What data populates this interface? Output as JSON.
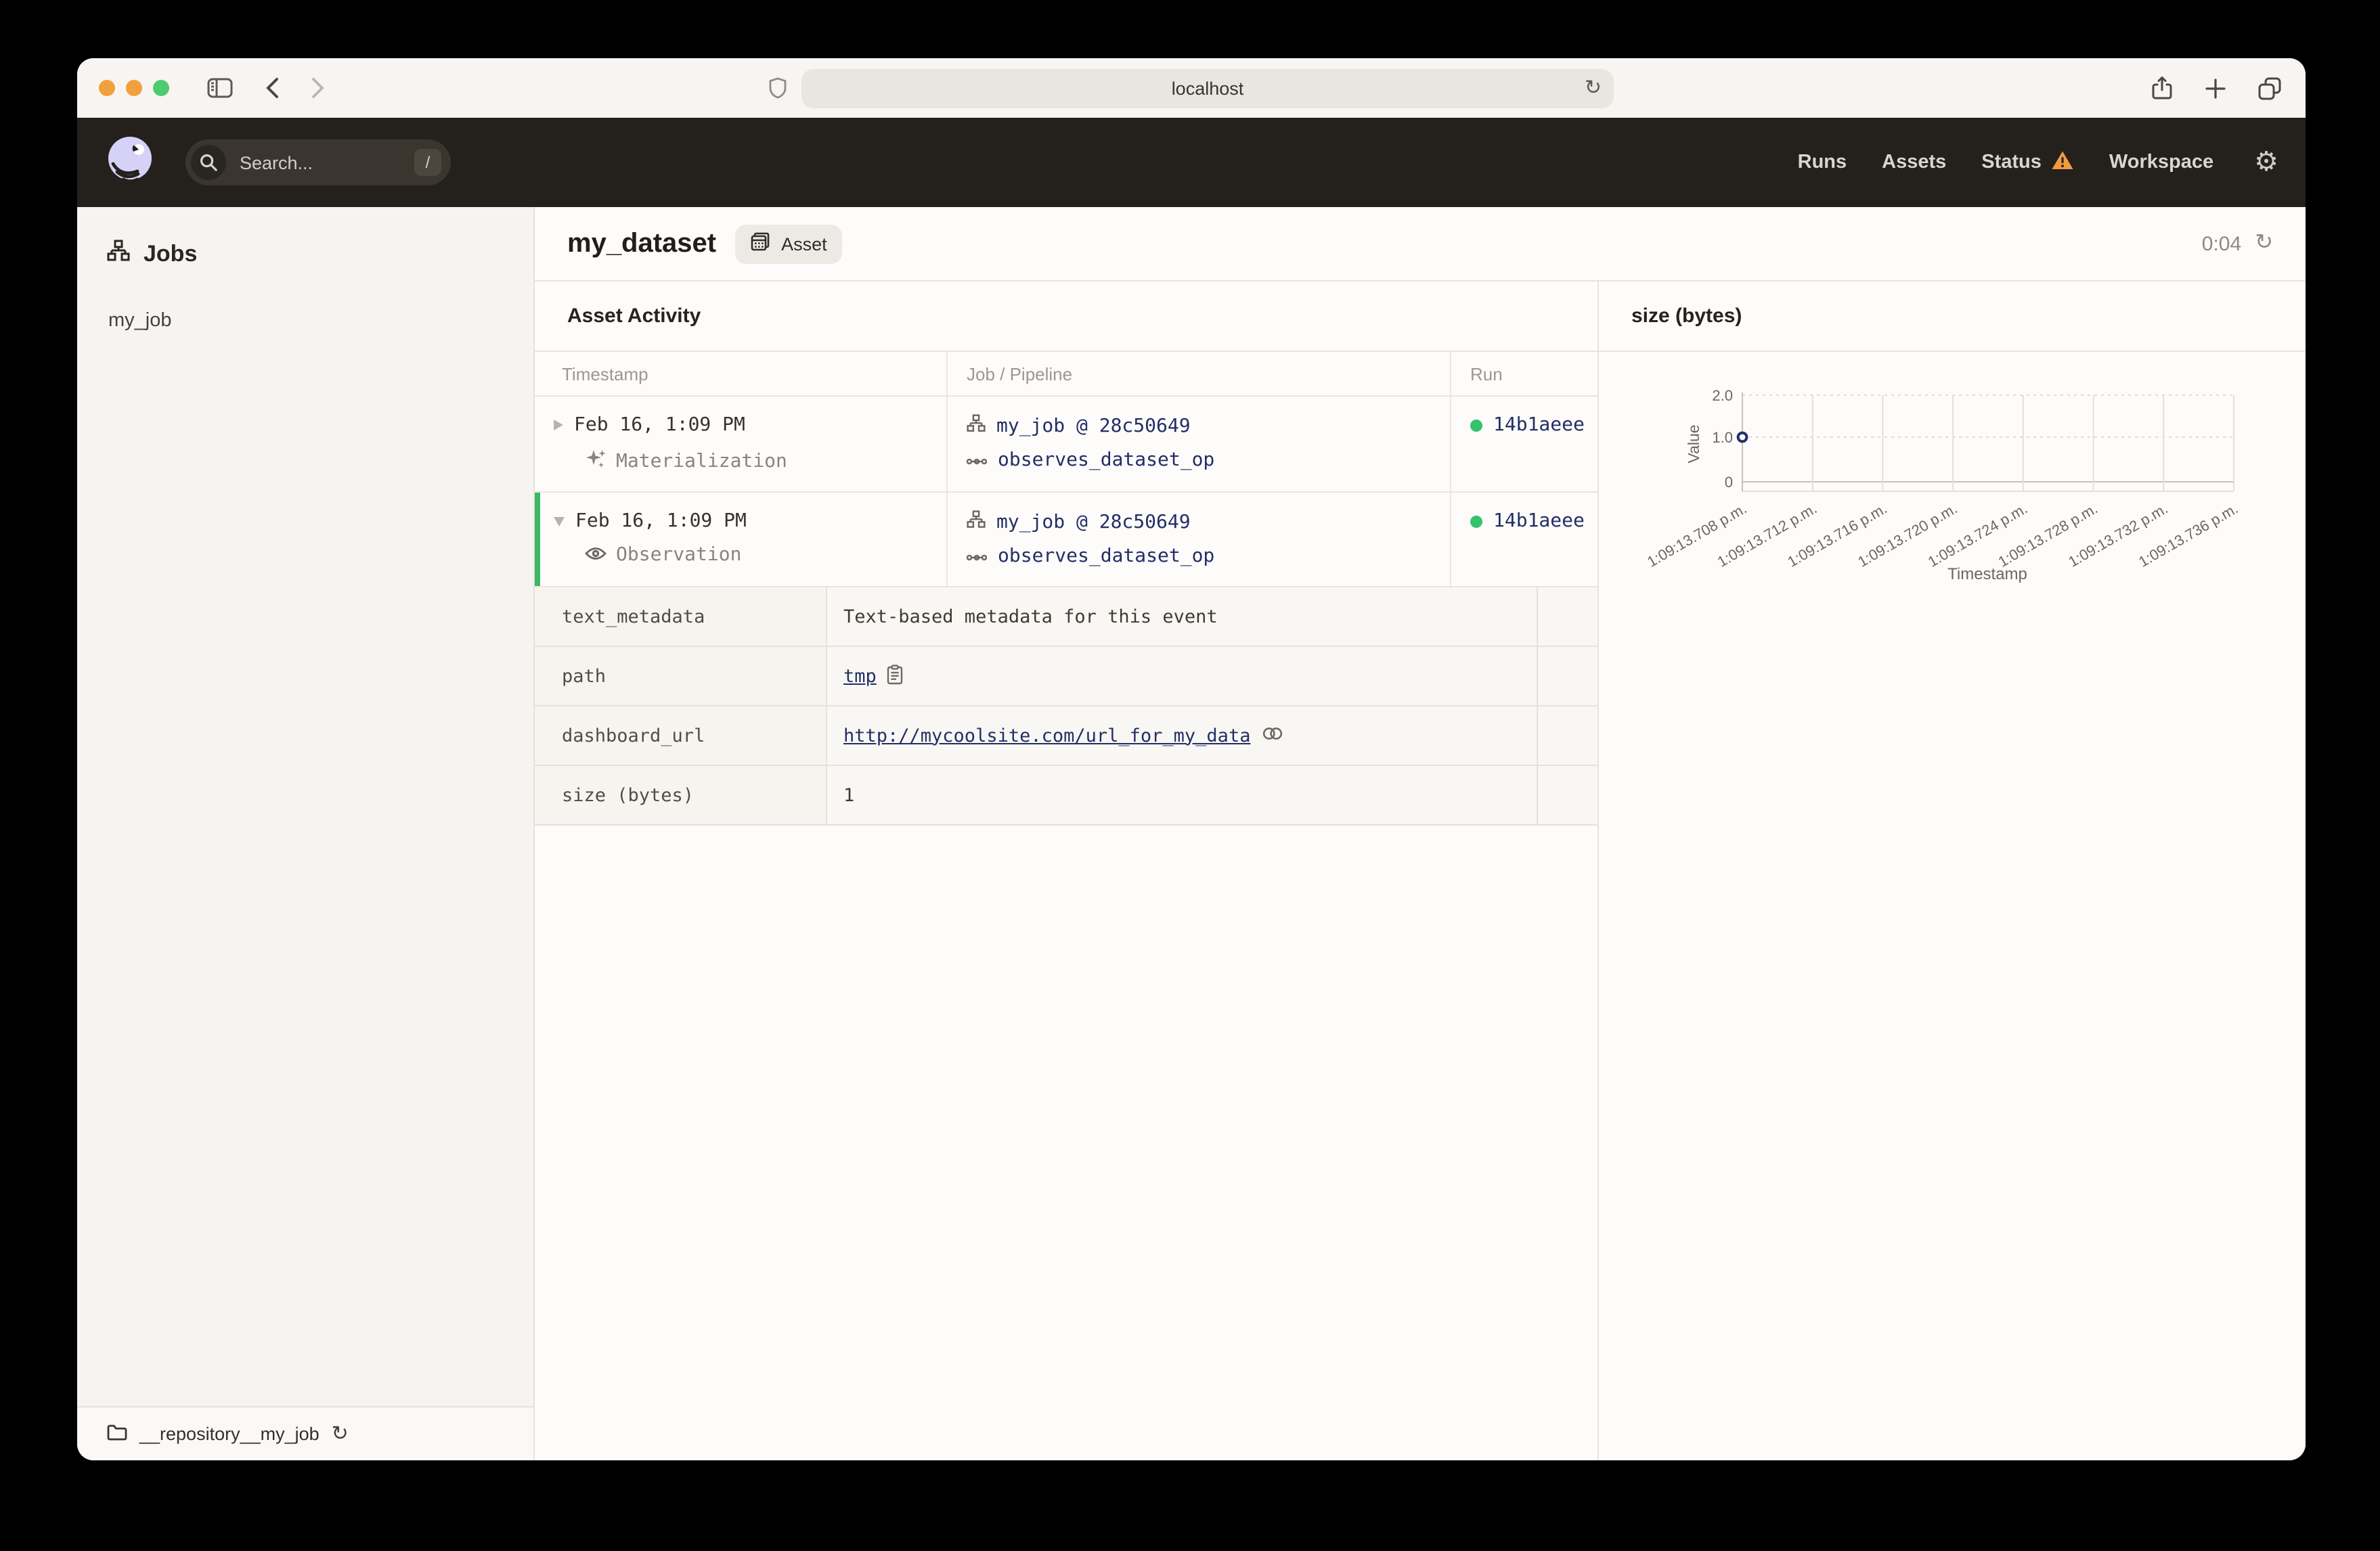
{
  "browser": {
    "url": "localhost"
  },
  "header": {
    "search_placeholder": "Search...",
    "search_shortcut": "/",
    "nav_runs": "Runs",
    "nav_assets": "Assets",
    "nav_status": "Status",
    "nav_workspace": "Workspace"
  },
  "sidebar": {
    "section_title": "Jobs",
    "jobs": [
      {
        "name": "my_job"
      }
    ],
    "repository": "__repository__my_job"
  },
  "page": {
    "title": "my_dataset",
    "badge": "Asset",
    "timer": "0:04"
  },
  "activity": {
    "panel_title": "Asset Activity",
    "col_timestamp": "Timestamp",
    "col_job": "Job / Pipeline",
    "col_run": "Run",
    "rows": [
      {
        "timestamp": "Feb 16, 1:09 PM",
        "event_type": "Materialization",
        "job": "my_job @ 28c50649",
        "op": "observes_dataset_op",
        "run_id": "14b1aeee",
        "expanded": false
      },
      {
        "timestamp": "Feb 16, 1:09 PM",
        "event_type": "Observation",
        "job": "my_job @ 28c50649",
        "op": "observes_dataset_op",
        "run_id": "14b1aeee",
        "expanded": true
      }
    ],
    "metadata": [
      {
        "key": "text_metadata",
        "value": "Text-based metadata for this event"
      },
      {
        "key": "path",
        "value": "tmp"
      },
      {
        "key": "dashboard_url",
        "value": "http://mycoolsite.com/url_for_my_data"
      },
      {
        "key": "size (bytes)",
        "value": "1"
      }
    ]
  },
  "chart_data": {
    "type": "scatter",
    "title": "size (bytes)",
    "xlabel": "Timestamp",
    "ylabel": "Value",
    "ylim": [
      0,
      2
    ],
    "grid": true,
    "legend": false,
    "y_tick_labels": [
      "2.0",
      "1.0",
      "0"
    ],
    "x_labels": [
      "1:09:13.708 p.m.",
      "1:09:13.712 p.m.",
      "1:09:13.716 p.m.",
      "1:09:13.720 p.m.",
      "1:09:13.724 p.m.",
      "1:09:13.728 p.m.",
      "1:09:13.732 p.m.",
      "1:09:13.736 p.m."
    ],
    "points": [
      {
        "x": "1:09:13.708 p.m.",
        "y": 1
      }
    ]
  },
  "colors": {
    "header_bg": "#24201c",
    "accent_green": "#3db666",
    "link_navy": "#232e66",
    "warning_orange": "#ef9b43",
    "logo_lavender": "#d6d1f6",
    "traffic_orange": "#f2a03d",
    "traffic_green": "#4ecb71"
  }
}
